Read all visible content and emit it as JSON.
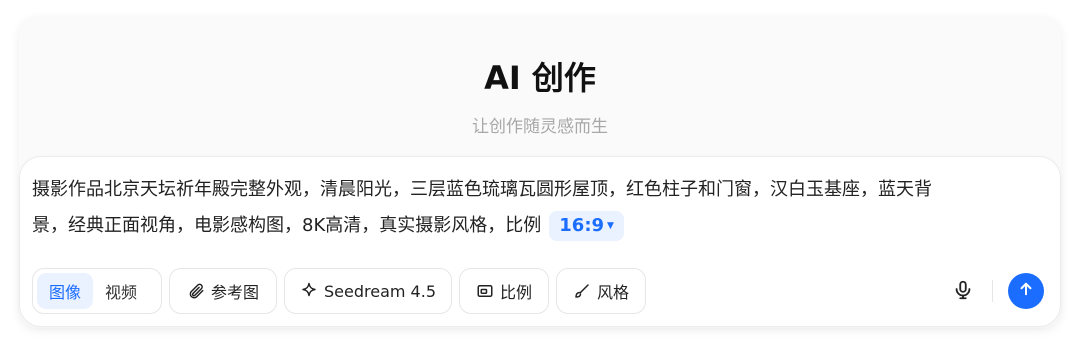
{
  "header": {
    "title": "AI 创作",
    "subtitle": "让创作随灵感而生"
  },
  "composer": {
    "prompt_line1": "摄影作品北京天坛祈年殿完整外观，清晨阳光，三层蓝色琉璃瓦圆形屋顶，红色柱子和门窗，汉白玉基座，蓝天背",
    "prompt_line2": "景，经典正面视角，电影感构图，8K高清，真实摄影风格，比例",
    "ratio_value": "16:9"
  },
  "toolbar": {
    "mode_image": "图像",
    "mode_video": "视频",
    "reference_label": "参考图",
    "model_label": "Seedream 4.5",
    "ratio_label": "比例",
    "style_label": "风格"
  },
  "colors": {
    "accent": "#1a6dff",
    "accent_bg": "#eaf1ff"
  },
  "icons": [
    "paperclip-icon",
    "sparkle-icon",
    "aspect-ratio-icon",
    "brush-icon",
    "mic-icon",
    "arrow-up-icon"
  ]
}
